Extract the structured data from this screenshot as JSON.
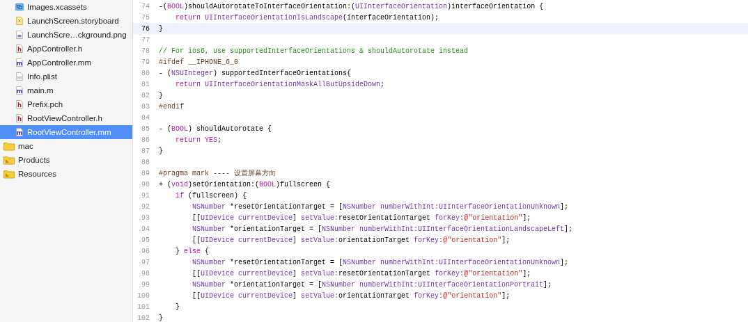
{
  "sidebar": {
    "files": [
      {
        "name": "Images.xcassets",
        "kind": "assets",
        "selected": false
      },
      {
        "name": "LaunchScreen.storyboard",
        "kind": "storyboard",
        "selected": false
      },
      {
        "name": "LaunchScre…ckground.png",
        "kind": "image",
        "selected": false
      },
      {
        "name": "AppController.h",
        "kind": "header",
        "icon_letter": "h",
        "selected": false
      },
      {
        "name": "AppController.mm",
        "kind": "source",
        "icon_letter": "m",
        "selected": false
      },
      {
        "name": "Info.plist",
        "kind": "plist",
        "selected": false
      },
      {
        "name": "main.m",
        "kind": "source",
        "icon_letter": "m",
        "selected": false
      },
      {
        "name": "Prefix.pch",
        "kind": "header",
        "icon_letter": "h",
        "selected": false
      },
      {
        "name": "RootViewController.h",
        "kind": "header",
        "icon_letter": "h",
        "selected": false
      },
      {
        "name": "RootViewController.mm",
        "kind": "source",
        "icon_letter": "m",
        "selected": true
      }
    ],
    "groups": [
      {
        "name": "mac",
        "kind": "folder",
        "selected": false
      },
      {
        "name": "Products",
        "kind": "group",
        "selected": false
      },
      {
        "name": "Resources",
        "kind": "group",
        "selected": false
      }
    ]
  },
  "editor": {
    "lines": [
      {
        "number": "74",
        "current": false,
        "tokens": [
          {
            "kind": "plain",
            "text": "-("
          },
          {
            "kind": "keyword",
            "text": "BOOL"
          },
          {
            "kind": "plain",
            "text": ")shouldAutorotateToInterfaceOrientation:("
          },
          {
            "kind": "type",
            "text": "UIInterfaceOrientation"
          },
          {
            "kind": "plain",
            "text": ")interfaceOrientation {"
          }
        ]
      },
      {
        "number": "75",
        "current": false,
        "tokens": [
          {
            "kind": "keyword",
            "text": "    return"
          },
          {
            "kind": "type",
            "text": " UIInterfaceOrientationIsLandscape"
          },
          {
            "kind": "plain",
            "text": "(interfaceOrientation);"
          }
        ]
      },
      {
        "number": "76",
        "current": true,
        "tokens": [
          {
            "kind": "plain",
            "text": "}"
          }
        ]
      },
      {
        "number": "77",
        "current": false
      },
      {
        "number": "78",
        "current": false,
        "tokens": [
          {
            "kind": "comment",
            "text": "// For ios6, use supportedInterfaceOrientations & shouldAutorotate instead"
          }
        ]
      },
      {
        "number": "79",
        "current": false,
        "tokens": [
          {
            "kind": "preprocessor",
            "text": "#ifdef __IPHONE_6_0"
          }
        ]
      },
      {
        "number": "80",
        "current": false,
        "tokens": [
          {
            "kind": "plain",
            "text": "- ("
          },
          {
            "kind": "type",
            "text": "NSUInteger"
          },
          {
            "kind": "plain",
            "text": ") supportedInterfaceOrientations{"
          }
        ]
      },
      {
        "number": "81",
        "current": false,
        "tokens": [
          {
            "kind": "keyword",
            "text": "    return"
          },
          {
            "kind": "type",
            "text": " UIInterfaceOrientationMaskAllButUpsideDown"
          },
          {
            "kind": "plain",
            "text": ";"
          }
        ]
      },
      {
        "number": "82",
        "current": false,
        "tokens": [
          {
            "kind": "plain",
            "text": "}"
          }
        ]
      },
      {
        "number": "83",
        "current": false,
        "tokens": [
          {
            "kind": "preprocessor",
            "text": "#endif"
          }
        ]
      },
      {
        "number": "84",
        "current": false
      },
      {
        "number": "85",
        "current": false,
        "tokens": [
          {
            "kind": "plain",
            "text": "- ("
          },
          {
            "kind": "keyword",
            "text": "BOOL"
          },
          {
            "kind": "plain",
            "text": ") shouldAutorotate {"
          }
        ]
      },
      {
        "number": "86",
        "current": false,
        "tokens": [
          {
            "kind": "keyword",
            "text": "    return YES"
          },
          {
            "kind": "plain",
            "text": ";"
          }
        ]
      },
      {
        "number": "87",
        "current": false,
        "tokens": [
          {
            "kind": "plain",
            "text": "}"
          }
        ]
      },
      {
        "number": "88",
        "current": false
      },
      {
        "number": "89",
        "current": false,
        "tokens": [
          {
            "kind": "preprocessor",
            "text": "#pragma mark ---- 设置屏幕方向"
          }
        ]
      },
      {
        "number": "90",
        "current": false,
        "tokens": [
          {
            "kind": "plain",
            "text": "+ ("
          },
          {
            "kind": "keyword",
            "text": "void"
          },
          {
            "kind": "plain",
            "text": ")setOrientation:("
          },
          {
            "kind": "keyword",
            "text": "BOOL"
          },
          {
            "kind": "plain",
            "text": ")fullscreen {"
          }
        ]
      },
      {
        "number": "91",
        "current": false,
        "tokens": [
          {
            "kind": "keyword",
            "text": "    if"
          },
          {
            "kind": "plain",
            "text": " (fullscreen) {"
          }
        ]
      },
      {
        "number": "92",
        "current": false,
        "tokens": [
          {
            "kind": "type",
            "text": "        NSNumber"
          },
          {
            "kind": "plain",
            "text": " *resetOrientationTarget = ["
          },
          {
            "kind": "type",
            "text": "NSNumber numberWithInt:UIInterfaceOrientationUnknown"
          },
          {
            "kind": "plain",
            "text": "];"
          }
        ]
      },
      {
        "number": "93",
        "current": false,
        "tokens": [
          {
            "kind": "plain",
            "text": "        [["
          },
          {
            "kind": "type",
            "text": "UIDevice currentDevice"
          },
          {
            "kind": "plain",
            "text": "] "
          },
          {
            "kind": "type",
            "text": "setValue:"
          },
          {
            "kind": "plain",
            "text": "resetOrientationTarget "
          },
          {
            "kind": "type",
            "text": "forKey:"
          },
          {
            "kind": "string",
            "text": "@\"orientation\""
          },
          {
            "kind": "plain",
            "text": "];"
          }
        ]
      },
      {
        "number": "94",
        "current": false,
        "tokens": [
          {
            "kind": "type",
            "text": "        NSNumber"
          },
          {
            "kind": "plain",
            "text": " *orientationTarget = ["
          },
          {
            "kind": "type",
            "text": "NSNumber numberWithInt:UIInterfaceOrientationLandscapeLeft"
          },
          {
            "kind": "plain",
            "text": "];"
          }
        ]
      },
      {
        "number": "95",
        "current": false,
        "tokens": [
          {
            "kind": "plain",
            "text": "        [["
          },
          {
            "kind": "type",
            "text": "UIDevice currentDevice"
          },
          {
            "kind": "plain",
            "text": "] "
          },
          {
            "kind": "type",
            "text": "setValue:"
          },
          {
            "kind": "plain",
            "text": "orientationTarget "
          },
          {
            "kind": "type",
            "text": "forKey:"
          },
          {
            "kind": "string",
            "text": "@\"orientation\""
          },
          {
            "kind": "plain",
            "text": "];"
          }
        ]
      },
      {
        "number": "96",
        "current": false,
        "tokens": [
          {
            "kind": "plain",
            "text": "    } "
          },
          {
            "kind": "keyword",
            "text": "else"
          },
          {
            "kind": "plain",
            "text": " {"
          }
        ]
      },
      {
        "number": "97",
        "current": false,
        "tokens": [
          {
            "kind": "type",
            "text": "        NSNumber"
          },
          {
            "kind": "plain",
            "text": " *resetOrientationTarget = ["
          },
          {
            "kind": "type",
            "text": "NSNumber numberWithInt:UIInterfaceOrientationUnknown"
          },
          {
            "kind": "plain",
            "text": "];"
          }
        ]
      },
      {
        "number": "98",
        "current": false,
        "tokens": [
          {
            "kind": "plain",
            "text": "        [["
          },
          {
            "kind": "type",
            "text": "UIDevice currentDevice"
          },
          {
            "kind": "plain",
            "text": "] "
          },
          {
            "kind": "type",
            "text": "setValue:"
          },
          {
            "kind": "plain",
            "text": "resetOrientationTarget "
          },
          {
            "kind": "type",
            "text": "forKey:"
          },
          {
            "kind": "string",
            "text": "@\"orientation\""
          },
          {
            "kind": "plain",
            "text": "];"
          }
        ]
      },
      {
        "number": "99",
        "current": false,
        "tokens": [
          {
            "kind": "type",
            "text": "        NSNumber"
          },
          {
            "kind": "plain",
            "text": " *orientationTarget = ["
          },
          {
            "kind": "type",
            "text": "NSNumber numberWithInt:UIInterfaceOrientationPortrait"
          },
          {
            "kind": "plain",
            "text": "];"
          }
        ]
      },
      {
        "number": "100",
        "current": false,
        "tokens": [
          {
            "kind": "plain",
            "text": "        [["
          },
          {
            "kind": "type",
            "text": "UIDevice currentDevice"
          },
          {
            "kind": "plain",
            "text": "] "
          },
          {
            "kind": "type",
            "text": "setValue:"
          },
          {
            "kind": "plain",
            "text": "orientationTarget "
          },
          {
            "kind": "type",
            "text": "forKey:"
          },
          {
            "kind": "string",
            "text": "@\"orientation\""
          },
          {
            "kind": "plain",
            "text": "];"
          }
        ]
      },
      {
        "number": "101",
        "current": false,
        "tokens": [
          {
            "kind": "plain",
            "text": "    }"
          }
        ]
      },
      {
        "number": "102",
        "current": false,
        "tokens": [
          {
            "kind": "plain",
            "text": "}"
          }
        ]
      }
    ]
  }
}
